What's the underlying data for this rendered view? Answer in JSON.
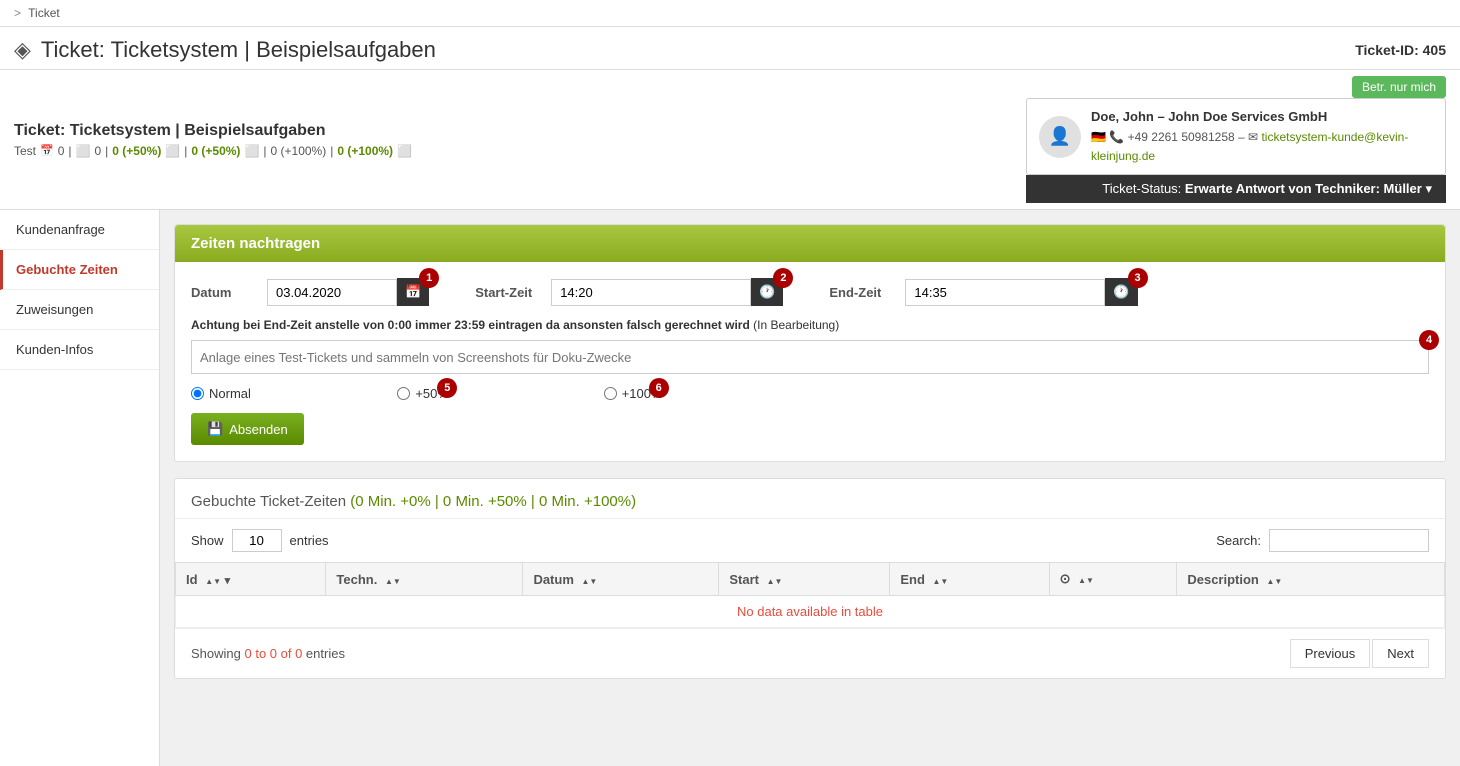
{
  "breadcrumb": {
    "separator": ">",
    "current": "Ticket"
  },
  "page_title": {
    "icon": "◈",
    "title": "Ticket: Ticketsystem | Beispielsaufgaben",
    "ticket_id_label": "Ticket-ID: 405"
  },
  "sub_header": {
    "title": "Ticket: Ticketsystem | Beispielsaufgaben",
    "stats_label": "Test",
    "stat1": "0",
    "stat2": "0",
    "stat3": "0 (+50%)",
    "stat4": "0 (+50%)",
    "stat5": "0 (+100%)",
    "stat6": "0 (+100%)"
  },
  "customer": {
    "name": "Doe, John – John Doe Services GmbH",
    "phone": "+49 2261 50981258",
    "email": "ticketsystem-kunde@kevin-kleinjung.de",
    "betr_button": "Betr. nur mich"
  },
  "status_bar": {
    "label": "Ticket-Status:",
    "status": "Erwarte Antwort von Techniker: Müller"
  },
  "sidebar": {
    "items": [
      {
        "id": "kundenanfrage",
        "label": "Kundenanfrage"
      },
      {
        "id": "gebuchte-zeiten",
        "label": "Gebuchte Zeiten"
      },
      {
        "id": "zuweisungen",
        "label": "Zuweisungen"
      },
      {
        "id": "kunden-infos",
        "label": "Kunden-Infos"
      }
    ]
  },
  "form_section": {
    "title": "Zeiten nachtragen",
    "datum_label": "Datum",
    "datum_value": "03.04.2020",
    "start_zeit_label": "Start-Zeit",
    "start_zeit_value": "14:20",
    "end_zeit_label": "End-Zeit",
    "end_zeit_value": "14:35",
    "warning": "Achtung bei End-Zeit anstelle von 0:00 immer 23:59 eintragen da ansonsten falsch gerechnet wird",
    "warning_note": "(In Bearbeitung)",
    "description_placeholder": "Anlage eines Test-Tickets und sammeln von Screenshots für Doku-Zwecke",
    "radio_normal": "Normal",
    "radio_50": "+50%",
    "radio_100": "+100%",
    "submit_label": "Absenden",
    "badge1": "1",
    "badge2": "2",
    "badge3": "3",
    "badge4": "4",
    "badge5": "5",
    "badge6": "6"
  },
  "table_section": {
    "title_prefix": "Gebuchte Ticket-Zeiten",
    "title_stats": "(0 Min. +0% | 0 Min. +50% | 0 Min. +100%)",
    "show_label": "Show",
    "show_value": "10",
    "entries_label": "entries",
    "search_label": "Search:",
    "search_value": "",
    "columns": [
      "Id",
      "Techn.",
      "Datum",
      "Start",
      "End",
      "⊙",
      "Description"
    ],
    "no_data": "No data available in table",
    "showing_text_start": "Showing ",
    "showing_highlight": "0 to 0 of 0",
    "showing_text_end": " entries",
    "prev_button": "Previous",
    "next_button": "Next"
  }
}
